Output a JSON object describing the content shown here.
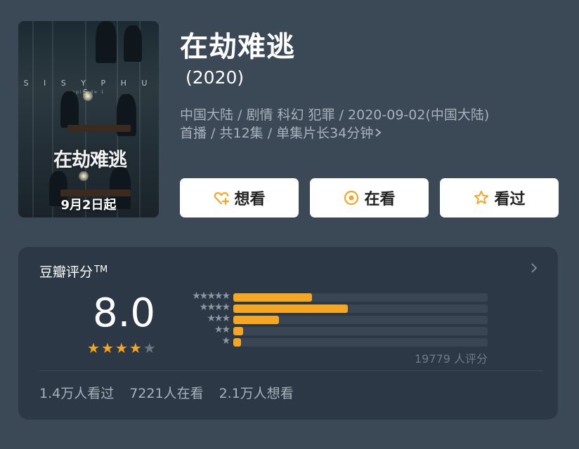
{
  "poster": {
    "brand": "S I S Y P H U S",
    "brand_sub": "episode 1",
    "title_cn": "在劫难逃",
    "date": "9月2日起"
  },
  "movie": {
    "title": "在劫难逃",
    "year": "(2020)",
    "meta_line1": "中国大陆 / 剧情 科幻 犯罪 / 2020-09-02(中国大陆)",
    "meta_line2": "首播 / 共12集 / 单集片长34分钟"
  },
  "actions": {
    "want": "想看",
    "watching": "在看",
    "watched": "看过"
  },
  "rating": {
    "title": "豆瓣评分",
    "tm": "TM",
    "score": "8.0",
    "stars_filled": 4,
    "stars_total": 5,
    "distribution": [
      {
        "stars": 5,
        "label": "★★★★★",
        "fraction": 0.31
      },
      {
        "stars": 4,
        "label": "★★★★",
        "fraction": 0.45
      },
      {
        "stars": 3,
        "label": "★★★",
        "fraction": 0.18
      },
      {
        "stars": 2,
        "label": "★★",
        "fraction": 0.04
      },
      {
        "stars": 1,
        "label": "★",
        "fraction": 0.03
      }
    ],
    "count_text": "19779 人评分"
  },
  "stats": {
    "watched": "1.4万人看过",
    "watching": "7221人在看",
    "want": "2.1万人想看"
  },
  "colors": {
    "background": "#3b4856",
    "card": "#2c3845",
    "accent": "#f5a623"
  }
}
